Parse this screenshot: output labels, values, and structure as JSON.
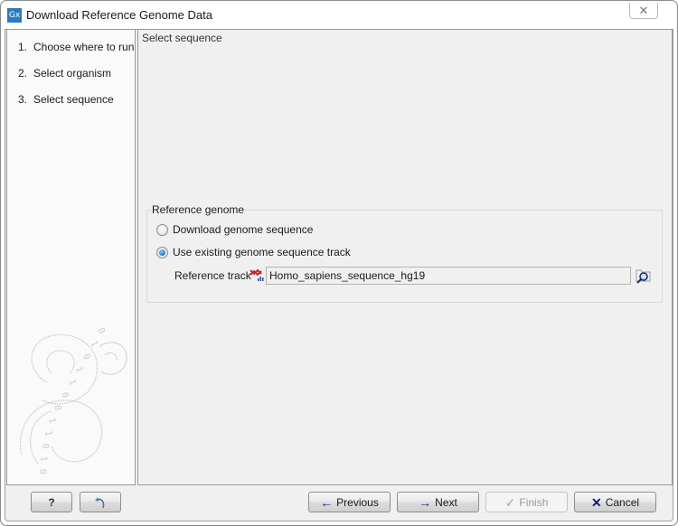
{
  "window": {
    "title": "Download Reference Genome Data",
    "app_icon_text": "Gx",
    "close_glyph": "✕"
  },
  "steps": [
    {
      "number": "1.",
      "label": "Choose where to run"
    },
    {
      "number": "2.",
      "label": "Select organism"
    },
    {
      "number": "3.",
      "label": "Select sequence"
    }
  ],
  "content": {
    "heading": "Select sequence",
    "group": {
      "title": "Reference genome",
      "options": [
        {
          "label": "Download genome sequence",
          "checked": false
        },
        {
          "label": "Use existing genome sequence track",
          "checked": true
        }
      ],
      "reference_track": {
        "label": "Reference track",
        "value": "Homo_sapiens_sequence_hg19",
        "icon": "sequence-track-icon",
        "browse_icon": "browse-folder-icon"
      }
    }
  },
  "footer": {
    "help_label": "?",
    "reset_icon": "undo-arrow-icon",
    "previous_label": "Previous",
    "next_label": "Next",
    "finish_label": "Finish",
    "cancel_label": "Cancel",
    "previous_glyph": "🡐",
    "next_glyph": "🡒",
    "finish_glyph": "✓",
    "cancel_glyph": "✕",
    "finish_enabled": false
  },
  "colors": {
    "accent": "#2a7bbf",
    "arrow": "#1e2a8c",
    "cancel_x": "#121a7a",
    "track_icon_red": "#c0282d",
    "track_icon_blue": "#2a4fa0"
  }
}
